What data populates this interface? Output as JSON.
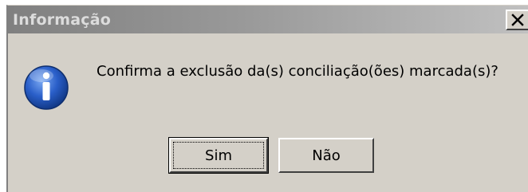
{
  "window": {
    "title": "Informação",
    "close_icon": "close-icon"
  },
  "dialog": {
    "icon": "info-icon",
    "message": "Confirma a exclusão da(s) conciliação(ões) marcada(s)?"
  },
  "buttons": {
    "yes_label": "Sim",
    "no_label": "Não"
  },
  "colors": {
    "dialog_bg": "#d4d0c8",
    "titlebar_start": "#808080",
    "titlebar_end": "#c0c0c0",
    "icon_blue": "#2a5fc9"
  }
}
